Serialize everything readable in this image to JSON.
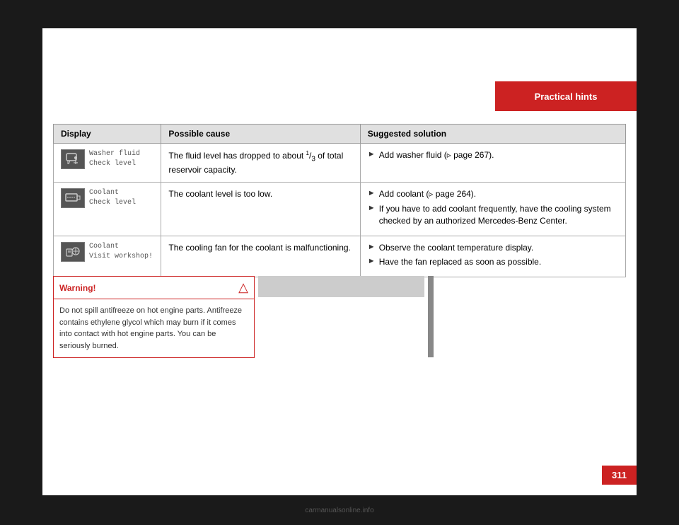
{
  "page": {
    "background_color": "#1a1a1a",
    "page_number": "311"
  },
  "section_tab": {
    "label": "Practical hints",
    "color": "#cc2222"
  },
  "table": {
    "headers": [
      "Display",
      "Possible cause",
      "Suggested solution"
    ],
    "rows": [
      {
        "id": "washer",
        "icon_label": "washer-fluid-icon",
        "display_text": "Washer fluid\nCheck level",
        "possible_cause": "The fluid level has dropped to about ¹⁄₃ of total reservoir capacity.",
        "solutions": [
          "Add washer fluid (▷ page 267)."
        ]
      },
      {
        "id": "coolant-low",
        "icon_label": "coolant-level-icon",
        "display_text": "Coolant\nCheck level",
        "possible_cause": "The coolant level is too low.",
        "solutions": [
          "Add coolant (▷ page 264).",
          "If you have to add coolant frequently, have the cooling system checked by an authorized Mercedes-Benz Center."
        ]
      },
      {
        "id": "coolant-fan",
        "icon_label": "coolant-fan-icon",
        "display_text": "Coolant\nVisit workshop!",
        "possible_cause": "The cooling fan for the coolant is malfunctioning.",
        "solutions": [
          "Observe the coolant temperature display.",
          "Have the fan replaced as soon as possible."
        ]
      }
    ]
  },
  "warning_box": {
    "header": "Warning!",
    "text": "Do not spill antifreeze on hot engine parts. Antifreeze contains ethylene glycol which may burn if it comes into contact with hot engine parts. You can be seriously burned."
  }
}
